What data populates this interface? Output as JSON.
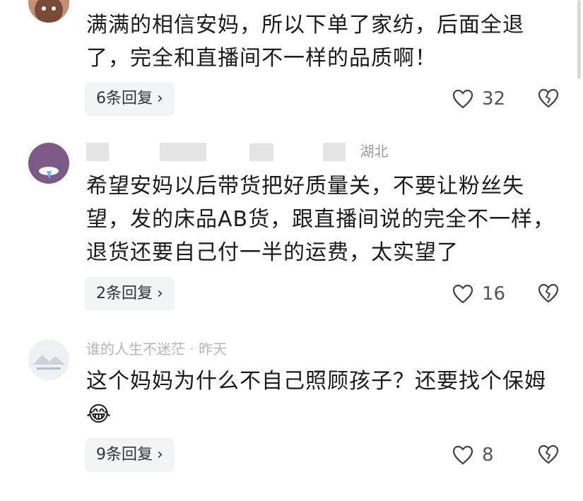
{
  "comments": [
    {
      "text": "满满的相信安妈，所以下单了家纺，后面全退了，完全和直播间不一样的品质啊！",
      "replies_label": "6条回复",
      "likes": "32"
    },
    {
      "text": "希望安妈以后带货把好质量关，不要让粉丝失望，发的床品AB货，跟直播间说的完全不一样，退货还要自己付一半的运费，太实望了",
      "meta_fragment": "湖北",
      "replies_label": "2条回复",
      "likes": "16"
    },
    {
      "text": "这个妈妈为什么不自己照顾孩子？还要找个保姆😂",
      "meta_fragment": "谁的人生不迷茫 · 昨天",
      "replies_label": "9条回复",
      "likes": "8"
    }
  ],
  "icons": {
    "like": "heart-outline-icon",
    "dislike": "broken-heart-icon",
    "chevron": "chevron-right-icon"
  },
  "colors": {
    "reply_button_bg": "#f3f4f6",
    "meta_gray": "#9a9a9a"
  }
}
